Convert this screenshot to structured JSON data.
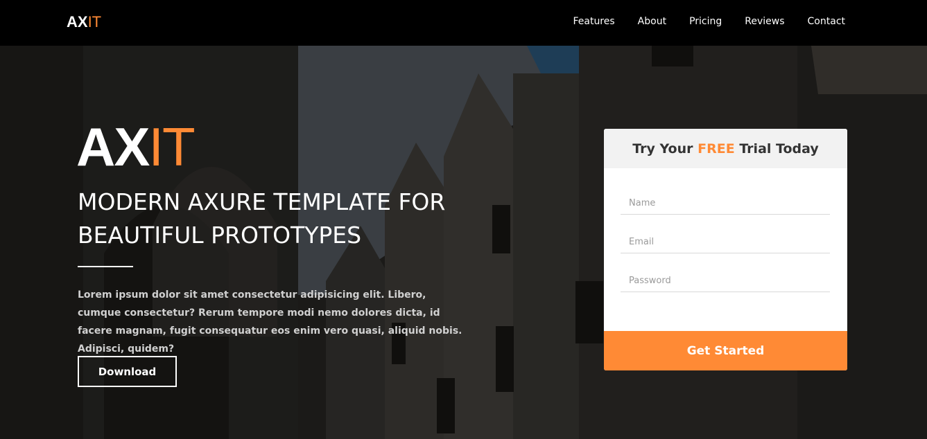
{
  "brand": {
    "part1": "AX",
    "part2": "IT"
  },
  "nav": {
    "items": [
      "Features",
      "About",
      "Pricing",
      "Reviews",
      "Contact"
    ]
  },
  "hero": {
    "logo_part1": "AX",
    "logo_part2": "IT",
    "heading_line1": "MODERN AXURE TEMPLATE FOR",
    "heading_line2": "BEAUTIFUL PROTOTYPES",
    "body": "Lorem ipsum dolor sit amet consectetur adipisicing elit. Libero, cumque consectetur? Rerum tempore modi nemo dolores dicta, id facere magnam, fugit consequatur eos enim vero quasi, aliquid nobis. Adipisci, quidem?",
    "download_label": "Download"
  },
  "trial": {
    "title_before": "Try Your",
    "title_accent": "FREE",
    "title_after": "Trial Today",
    "name_placeholder": "Name",
    "email_placeholder": "Email",
    "password_placeholder": "Password",
    "submit_label": "Get Started"
  },
  "colors": {
    "accent": "#ff8a35",
    "navbar": "#000000"
  }
}
